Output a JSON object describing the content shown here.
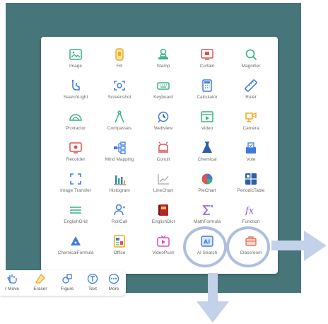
{
  "tools": [
    {
      "label": "Image",
      "icon": "image-icon"
    },
    {
      "label": "Fill",
      "icon": "fill-icon"
    },
    {
      "label": "Stamp",
      "icon": "stamp-icon"
    },
    {
      "label": "Curtain",
      "icon": "curtain-icon"
    },
    {
      "label": "Magnifier",
      "icon": "magnifier-icon"
    },
    {
      "label": "SearchLight",
      "icon": "searchlight-icon"
    },
    {
      "label": "Screenshot",
      "icon": "screenshot-icon"
    },
    {
      "label": "Keyboard",
      "icon": "keyboard-icon"
    },
    {
      "label": "Calculator",
      "icon": "calculator-icon"
    },
    {
      "label": "Ruler",
      "icon": "ruler-icon"
    },
    {
      "label": "Protractor",
      "icon": "protractor-icon"
    },
    {
      "label": "Compasses",
      "icon": "compasses-icon"
    },
    {
      "label": "Webview",
      "icon": "webview-icon"
    },
    {
      "label": "Video",
      "icon": "video-icon"
    },
    {
      "label": "Camera",
      "icon": "camera-icon"
    },
    {
      "label": "Recorder",
      "icon": "recorder-icon"
    },
    {
      "label": "Mind Mapping",
      "icon": "mind-mapping-icon"
    },
    {
      "label": "Conuit",
      "icon": "conuit-icon"
    },
    {
      "label": "Chemical",
      "icon": "chemical-icon"
    },
    {
      "label": "Vote",
      "icon": "vote-icon"
    },
    {
      "label": "Image Transfer",
      "icon": "image-transfer-icon"
    },
    {
      "label": "Histogram",
      "icon": "histogram-icon"
    },
    {
      "label": "LineChart",
      "icon": "line-chart-icon"
    },
    {
      "label": "PieChart",
      "icon": "pie-chart-icon"
    },
    {
      "label": "PeriodicTable",
      "icon": "periodic-table-icon"
    },
    {
      "label": "EnglishGrid",
      "icon": "english-grid-icon"
    },
    {
      "label": "RollCall",
      "icon": "roll-call-icon"
    },
    {
      "label": "EnglishDict",
      "icon": "english-dict-icon"
    },
    {
      "label": "MathFormula",
      "icon": "math-formula-icon"
    },
    {
      "label": "Function",
      "icon": "function-icon"
    },
    {
      "label": "ChemicalFormula",
      "icon": "chemical-formula-icon"
    },
    {
      "label": "Office",
      "icon": "office-icon"
    },
    {
      "label": "VideoPush",
      "icon": "video-push-icon"
    },
    {
      "label": "AI Search",
      "icon": "ai-search-icon"
    },
    {
      "label": "Classroom",
      "icon": "classroom-icon"
    }
  ],
  "bottom_bar": [
    {
      "label": "r Move",
      "icon": "move-hand-icon"
    },
    {
      "label": "Eraser",
      "icon": "eraser-icon"
    },
    {
      "label": "Figure",
      "icon": "figure-icon"
    },
    {
      "label": "Text",
      "icon": "text-icon"
    },
    {
      "label": "More",
      "icon": "more-icon"
    }
  ],
  "colors": {
    "background": "#46767a",
    "highlight_ring": "#aebedf",
    "arrow": "#c3d1ea"
  }
}
